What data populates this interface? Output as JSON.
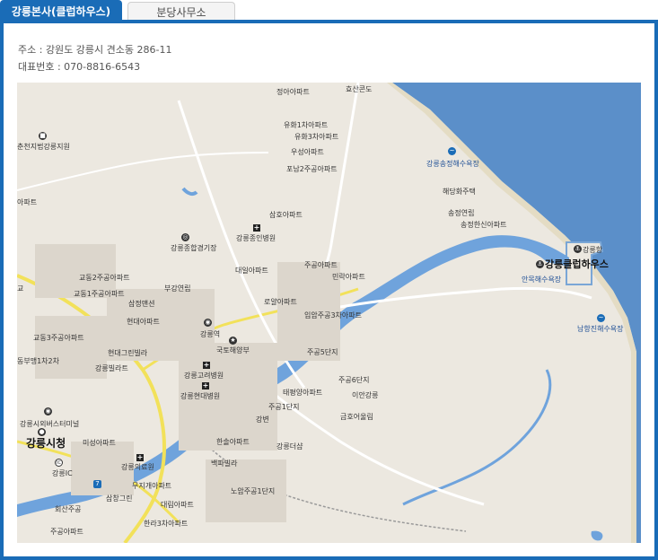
{
  "tabs": [
    {
      "label": "강릉본사(클럽하우스)",
      "active": true
    },
    {
      "label": "분당사무소",
      "active": false
    }
  ],
  "info": {
    "address": "주소 : 강원도 강릉시 견소동 286-11",
    "phone": "대표번호 : 070-8816-6543"
  },
  "colors": {
    "accent": "#1a6cb7",
    "sea": "#5b8fc9",
    "river": "#6fa3dc",
    "land": "#ece8e0"
  },
  "map": {
    "labels": [
      "정아아파트",
      "효산콘도",
      "유화1차아파트",
      "유화3차아파트",
      "우성아파트",
      "포남2주공아파트",
      "춘천지법강릉지원",
      "강릉송정해수욕장",
      "해당화주택",
      "아파트",
      "삼호아파트",
      "송정연립",
      "송정한신아파트",
      "강릉종인병원",
      "강릉종합경기장",
      "강릉항",
      "대일아파트",
      "주공아파트",
      "강릉클럽하우스",
      "교동2주공아파트",
      "안목해수욕장",
      "교동1주공아파트",
      "부강연립",
      "민락아파트",
      "교",
      "삼정맨션",
      "로얄아파트",
      "입암주공3차아파트",
      "현대아파트",
      "남항진해수욕장",
      "강릉역",
      "교동3주공아파트",
      "국토해양부",
      "현대그린빌라",
      "주공5단지",
      "동부맹1차2차",
      "강릉빌라트",
      "강릉고려병원",
      "주공6단지",
      "태평양아파트",
      "이안강릉",
      "강릉현대병원",
      "주공1단지",
      "금호어울림",
      "강변",
      "강릉시외버스터미널",
      "한솔아파트",
      "강릉더샵",
      "강릉시청",
      "미성아파트",
      "백파빌라",
      "강릉IC",
      "강릉의료원",
      "무지개아파트",
      "노암주공1단지",
      "삼창그린",
      "대림아파트",
      "회산주공",
      "한라3차아파트",
      "주공아파트"
    ],
    "icons": {
      "ic": "IC",
      "highway": "7"
    }
  }
}
